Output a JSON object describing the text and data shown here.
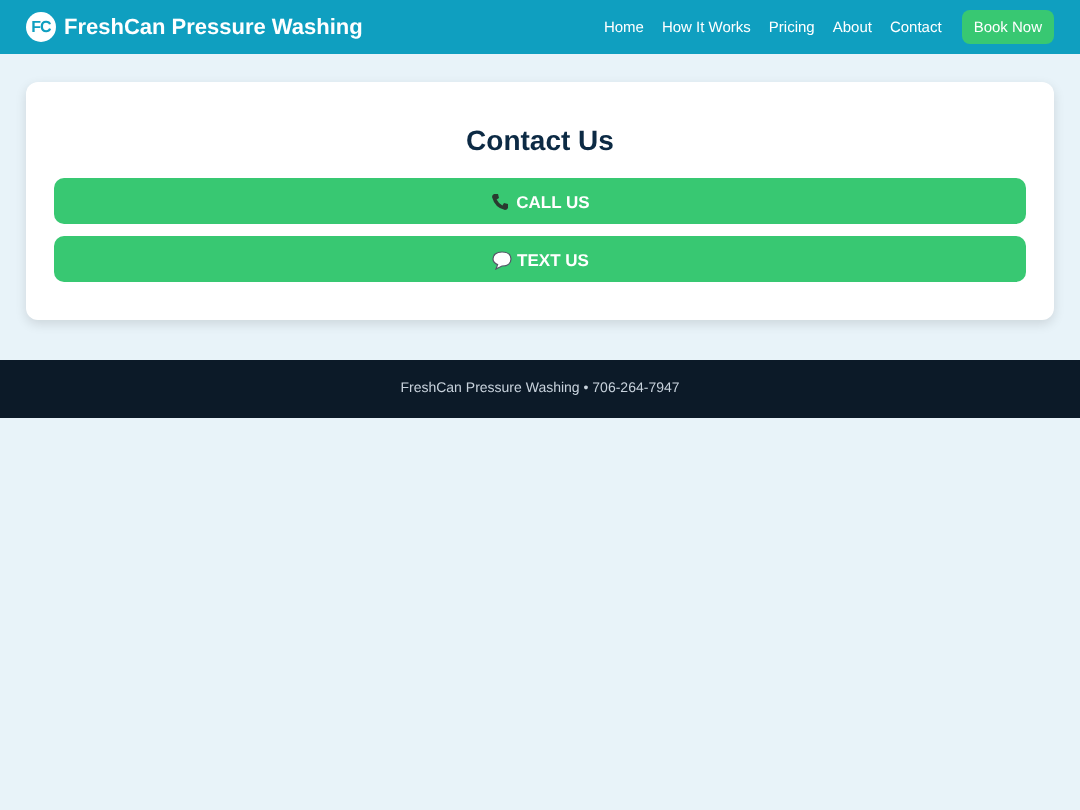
{
  "header": {
    "logo_mark": "FC",
    "brand": "FreshCan Pressure Washing",
    "nav": [
      "Home",
      "How It Works",
      "Pricing",
      "About",
      "Contact"
    ],
    "cta": "Book Now"
  },
  "contact": {
    "title": "Contact Us",
    "buttons": [
      {
        "kind": "phone",
        "label": "CALL US"
      },
      {
        "kind": "message",
        "label": "TEXT US"
      }
    ]
  },
  "footer": {
    "text": "FreshCan Pressure Washing • 706-264-7947"
  }
}
